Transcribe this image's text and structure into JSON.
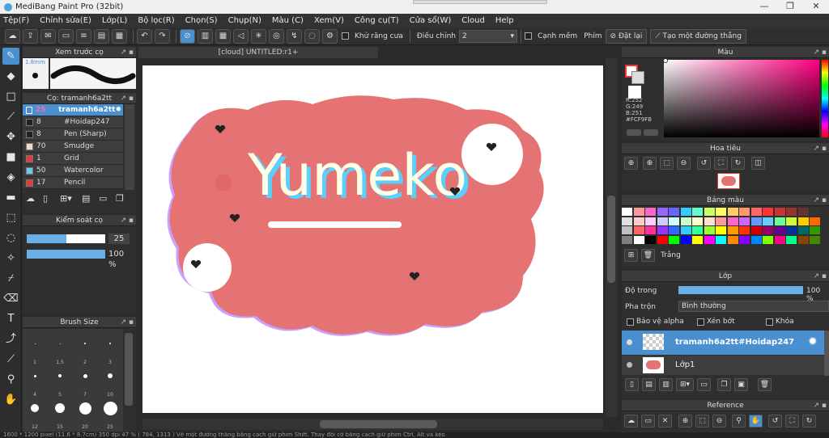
{
  "window": {
    "title": "MediBang Paint Pro (32bit)"
  },
  "menu": [
    "Tệp(F)",
    "Chỉnh sửa(E)",
    "Lớp(L)",
    "Bộ lọc(R)",
    "Chọn(S)",
    "Chụp(N)",
    "Màu (C)",
    "Xem(V)",
    "Công cụ(T)",
    "Cửa sổ(W)",
    "Cloud",
    "Help"
  ],
  "toolbar": {
    "antialias_label": "Khử răng cưa",
    "adjust_label": "Điều chỉnh",
    "adjust_value": "2",
    "sharp_label": "Cạnh mềm",
    "key_label": "Phím",
    "reset_label": "Đặt lại",
    "line_label": "Tạo một đường thẳng"
  },
  "brush_preview": {
    "title": "Xem trước cọ",
    "size": "1.8mm"
  },
  "brush_panel": {
    "title": "Cọ: tramanh6a2tt",
    "items": [
      {
        "size": "25",
        "name": "tramanh6a2tt",
        "color": "#4a8fd0",
        "selected": true
      },
      {
        "size": "8",
        "name": "#Hoidap247",
        "color": "#222222"
      },
      {
        "size": "8",
        "name": "Pen (Sharp)",
        "color": "#222222"
      },
      {
        "size": "70",
        "name": "Smudge",
        "color": "#f3d9c8"
      },
      {
        "size": "1",
        "name": "Grid",
        "color": "#e53935"
      },
      {
        "size": "50",
        "name": "Watercolor",
        "color": "#6ec6f2"
      },
      {
        "size": "17",
        "name": "Pencil",
        "color": "#e53935"
      }
    ]
  },
  "brush_control": {
    "title": "Kiểm soát cọ",
    "size_value": "25",
    "opacity_value": "100 %",
    "size_fraction": 0.5,
    "opacity_fraction": 1.0
  },
  "brush_size": {
    "title": "Brush Size",
    "labels": [
      "1",
      "1.5",
      "2",
      "3",
      "4",
      "5",
      "7",
      "10",
      "12",
      "15",
      "20",
      "25"
    ]
  },
  "document": {
    "tab": "[cloud] UNTITLED:r1+",
    "artwork_text": "Yumeko",
    "cloud_color": "#e57373"
  },
  "color_panel": {
    "title": "Màu",
    "r": "R:252",
    "g": "G:249",
    "b": "B:251",
    "hex": "#FCF9FB"
  },
  "navigator": {
    "title": "Hoa tiêu"
  },
  "palette": {
    "title": "Bảng màu",
    "swatch_label": "Trắng",
    "colors": [
      "#ffffff",
      "#ff9999",
      "#ff66cc",
      "#9966ff",
      "#6666ff",
      "#33ccff",
      "#66ffcc",
      "#ccff66",
      "#ffff66",
      "#ffcc66",
      "#ff9966",
      "#ff6666",
      "#ff3333",
      "#cc3333",
      "#993333",
      "#663333",
      "#333333",
      "#e0e0e0",
      "#ffcccc",
      "#ffccff",
      "#ccccff",
      "#ccffff",
      "#ccffcc",
      "#ffffcc",
      "#ffe0cc",
      "#ff9999",
      "#ff66cc",
      "#cc66ff",
      "#6699ff",
      "#66ccff",
      "#66ff99",
      "#ccff33",
      "#ffcc00",
      "#ff6600",
      "#c0c0c0",
      "#ff6666",
      "#ff3399",
      "#9933ff",
      "#3366ff",
      "#33ccff",
      "#33ff99",
      "#99ff33",
      "#ffff00",
      "#ff9900",
      "#ff3300",
      "#cc0000",
      "#990066",
      "#660099",
      "#003399",
      "#006666",
      "#339900",
      "#808080",
      "#ffffff",
      "#000000",
      "#ff0000",
      "#00ff00",
      "#0000ff",
      "#ffff00",
      "#ff00ff",
      "#00ffff",
      "#ff8800",
      "#8800ff",
      "#0088ff",
      "#88ff00",
      "#ff0088",
      "#00ff88",
      "#884400",
      "#448800"
    ]
  },
  "layer_panel": {
    "title": "Lớp",
    "opacity_label": "Độ trong",
    "opacity_value": "100 %",
    "opacity_fraction": 1.0,
    "blend_label": "Pha trộn",
    "blend_value": "Bình thường",
    "protect_alpha": "Bảo vệ alpha",
    "clipping": "Xén bớt",
    "lock": "Khóa",
    "layers": [
      {
        "name": "tramanh6a2tt#Hoidap247",
        "selected": true
      },
      {
        "name": "Lớp1",
        "selected": false
      }
    ]
  },
  "reference": {
    "title": "Reference"
  },
  "status": "1600 * 1200 pixel  (11.6 * 8.7cm)  350 dpi  47 %  ( 784, 1313 )  Vẽ một đường thẳng bằng cách giữ phím Shift. Thay đổi cỡ bằng cách giữ phím Ctrl, Alt và kéo"
}
